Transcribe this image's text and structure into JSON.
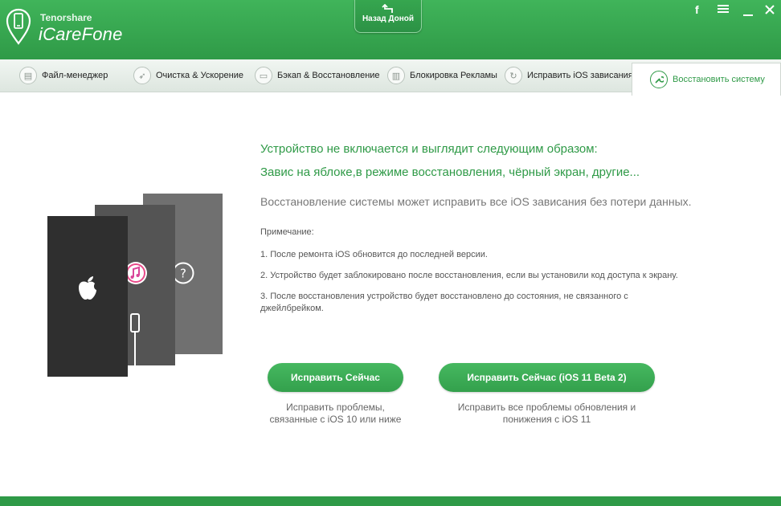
{
  "header": {
    "brand_small": "Tenorshare",
    "brand_big": "iCareFone",
    "home_button": "Назад Доной",
    "controls": [
      "facebook-icon",
      "menu-icon",
      "minimize-icon",
      "close-icon"
    ]
  },
  "tabs": [
    {
      "label": "Файл-менеджер",
      "icon": "file-manager-icon"
    },
    {
      "label": "Очистка & Ускорение",
      "icon": "rocket-icon"
    },
    {
      "label": "Бэкап & Восстановление",
      "icon": "backup-icon"
    },
    {
      "label": "Блокировка Рекламы",
      "icon": "trash-icon"
    },
    {
      "label": "Исправить iOS зависания",
      "icon": "refresh-icon"
    },
    {
      "label": "Восстановить систему",
      "icon": "wrench-icon",
      "active": true
    }
  ],
  "main": {
    "headline1": "Устройство не включается и выглядит следующим образом:",
    "headline2": "Завис на яблоке,в режиме восстановления, чёрный экран, другие...",
    "subtext": "Восстановление системы может исправить все iOS зависания без потери данных.",
    "note_label": "Примечание:",
    "notes": [
      "1. После ремонта iOS обновится до последней версии.",
      "2. Устройство будет заблокировано после восстановления, если вы установили код доступа к экрану.",
      "3. После восстановления устройство будет восстановлено до состояния, не связанного с",
      "джейлбрейком."
    ],
    "buttons": [
      {
        "label": "Исправить Сейчас",
        "caption1": "Исправить проблемы,",
        "caption2": "связанные с iOS 10 или ниже"
      },
      {
        "label": "Исправить Сейчас (iOS 11 Beta 2)",
        "caption1": "Исправить все проблемы обновления и",
        "caption2": "понижения с iOS 11"
      }
    ]
  },
  "colors": {
    "brand_green": "#2f9a47",
    "accent_green": "#40b45a"
  }
}
